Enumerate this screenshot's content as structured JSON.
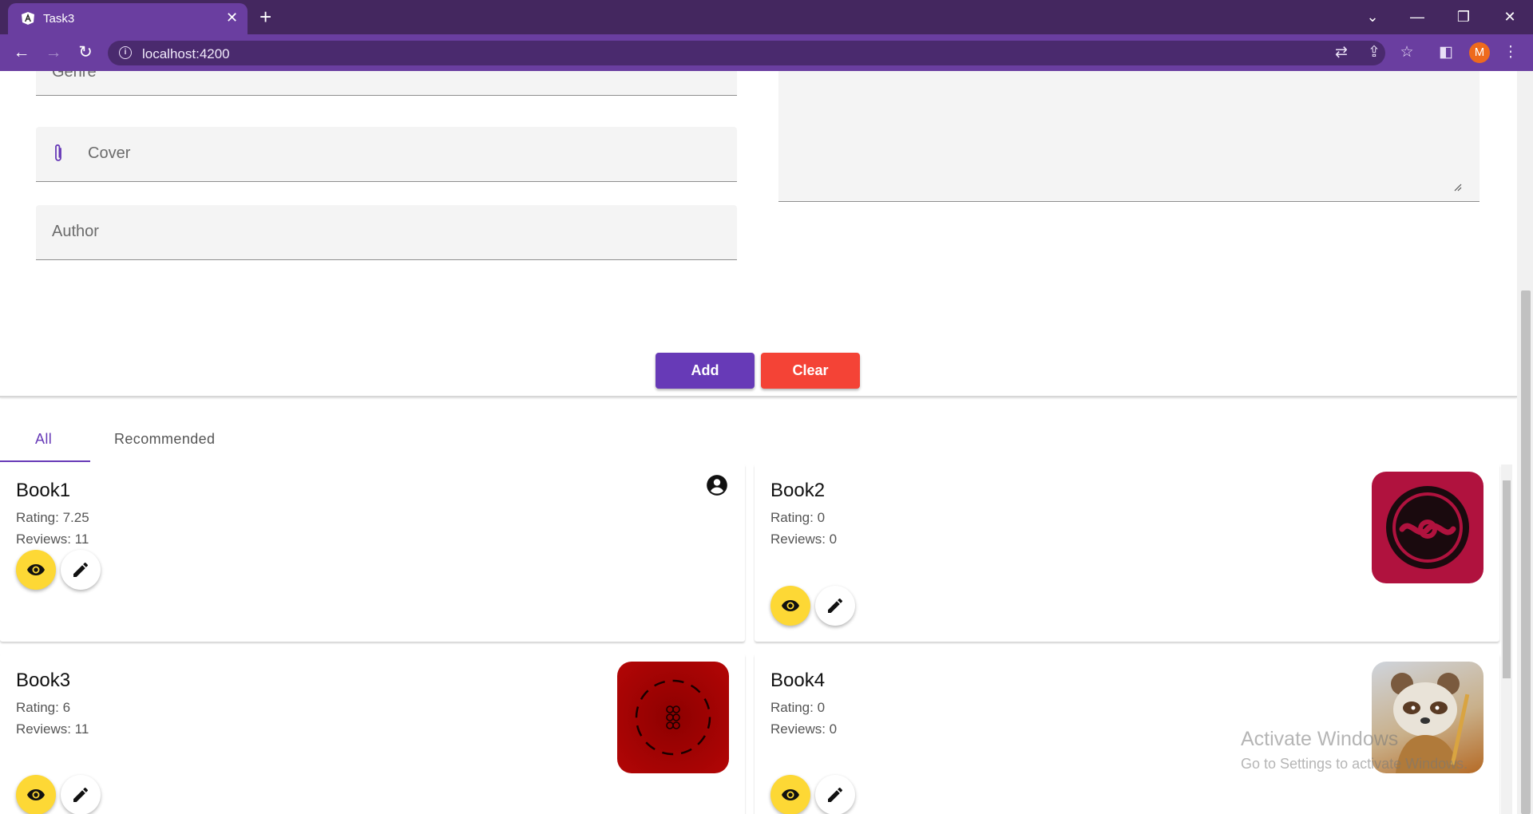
{
  "browser": {
    "tab_title": "Task3",
    "url": "localhost:4200",
    "profile_initial": "M"
  },
  "form": {
    "genre_label": "Genre",
    "cover_label": "Cover",
    "author_label": "Author",
    "add_label": "Add",
    "clear_label": "Clear"
  },
  "tabs": [
    {
      "label": "All",
      "active": true
    },
    {
      "label": "Recommended",
      "active": false
    }
  ],
  "books": [
    {
      "title": "Book1",
      "rating": "Rating: 7.25",
      "reviews": "Reviews: 11",
      "cover": "account-circle-icon"
    },
    {
      "title": "Book2",
      "rating": "Rating: 0",
      "reviews": "Reviews: 0",
      "cover": "knot-logo-cover"
    },
    {
      "title": "Book3",
      "rating": "Rating: 6",
      "reviews": "Reviews: 11",
      "cover": "dashed-circle-cover"
    },
    {
      "title": "Book4",
      "rating": "Rating: 0",
      "reviews": "Reviews: 0",
      "cover": "panda-cover"
    }
  ],
  "watermark": {
    "line1": "Activate Windows",
    "line2": "Go to Settings to activate Windows."
  },
  "colors": {
    "primary": "#673ab7",
    "warn": "#f44336",
    "view_fab": "#fdd835",
    "chrome_dark": "#44275f",
    "chrome_light": "#6a3ea0"
  }
}
